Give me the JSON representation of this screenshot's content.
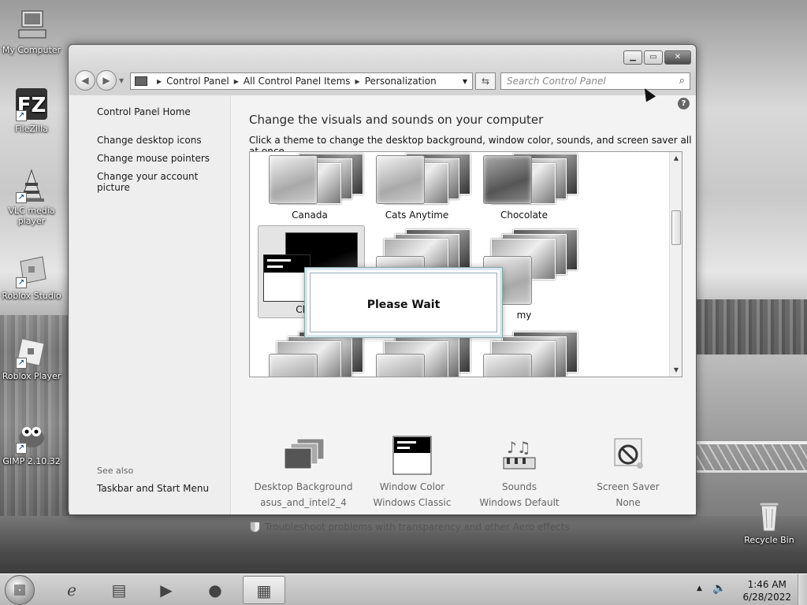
{
  "desktop": {
    "icons": [
      {
        "label": "My Computer"
      },
      {
        "label": "FileZilla"
      },
      {
        "label": "VLC media player"
      },
      {
        "label": "Roblox Studio"
      },
      {
        "label": "Roblox Player"
      },
      {
        "label": "GIMP 2.10.32"
      },
      {
        "label": "Recycle Bin"
      }
    ]
  },
  "window": {
    "address": {
      "crumbs": [
        "Control Panel",
        "All Control Panel Items",
        "Personalization"
      ]
    },
    "search": {
      "placeholder": "Search Control Panel"
    },
    "left_pane": {
      "home_link": "Control Panel Home",
      "links": [
        "Change desktop icons",
        "Change mouse pointers",
        "Change your account picture"
      ],
      "see_also_heading": "See also",
      "see_also_links": [
        "Taskbar and Start Menu"
      ]
    },
    "main": {
      "title": "Change the visuals and sounds on your computer",
      "subtitle": "Click a theme to change the desktop background, window color, sounds, and screen saver all at once.",
      "themes": [
        {
          "label": "Canada"
        },
        {
          "label": "Cats Anytime"
        },
        {
          "label": "Chocolate"
        },
        {
          "label": "Classic"
        },
        {
          "label": ""
        },
        {
          "label": "my"
        }
      ],
      "dialog": {
        "text": "Please Wait"
      },
      "settings": [
        {
          "title": "Desktop Background",
          "value": "asus_and_intel2_4"
        },
        {
          "title": "Window Color",
          "value": "Windows Classic"
        },
        {
          "title": "Sounds",
          "value": "Windows Default"
        },
        {
          "title": "Screen Saver",
          "value": "None"
        }
      ],
      "aero_link": "Troubleshoot problems with transparency and other Aero effects"
    }
  },
  "taskbar": {
    "clock": {
      "time": "1:46 AM",
      "date": "6/28/2022"
    }
  }
}
